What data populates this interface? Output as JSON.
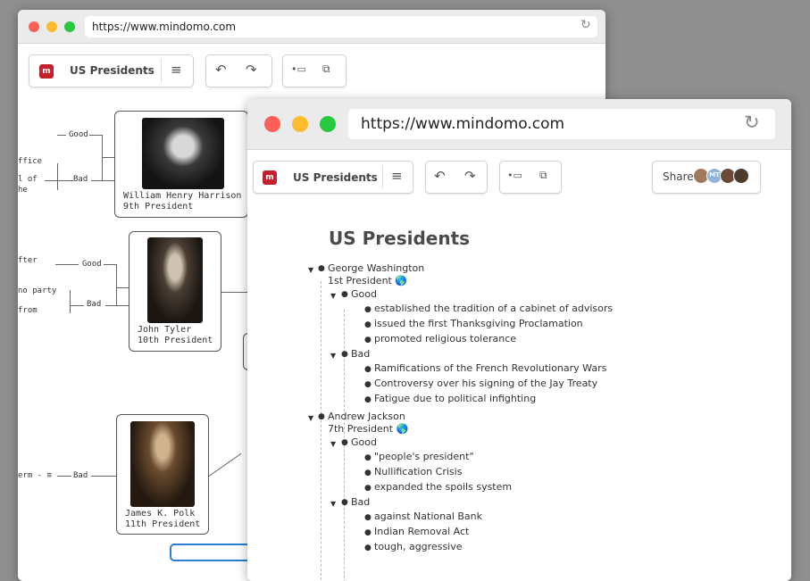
{
  "back_window": {
    "url": "https://www.mindomo.com",
    "title": "US Presidents",
    "nodes": [
      {
        "name": "William Henry Harrison",
        "subtitle": "9th President"
      },
      {
        "name": "John Tyler",
        "subtitle": "10th President"
      },
      {
        "name": "James K. Polk",
        "subtitle": "11th President"
      }
    ],
    "branch_good": "Good",
    "branch_bad": "Bad",
    "fragments": {
      "f1": "ffice",
      "f2": "l of",
      "f3": "he",
      "f4": "fter",
      "f5": "no party",
      "f6": "from",
      "f7": "erm - ≡"
    }
  },
  "front_window": {
    "url": "https://www.mindomo.com",
    "title": "US Presidents",
    "share_label": "Share",
    "avatar_initials": "MT",
    "heading": "US Presidents",
    "outline": [
      {
        "name": "George Washington",
        "subtitle": "1st President 🌎",
        "good_label": "Good",
        "good": [
          "established the tradition of a cabinet of advisors",
          "issued the first Thanksgiving Proclamation",
          "promoted religious tolerance"
        ],
        "bad_label": "Bad",
        "bad": [
          "Ramifications of the French Revolutionary Wars",
          "Controversy over his signing of the Jay Treaty",
          "Fatigue due to political infighting"
        ]
      },
      {
        "name": "Andrew Jackson",
        "subtitle": "7th President 🌎",
        "good_label": "Good",
        "good": [
          "\"people's president\"",
          "Nullification Crisis",
          "expanded the spoils system"
        ],
        "bad_label": "Bad",
        "bad": [
          "against National Bank",
          "Indian Removal Act",
          "tough, aggressive"
        ]
      }
    ]
  }
}
